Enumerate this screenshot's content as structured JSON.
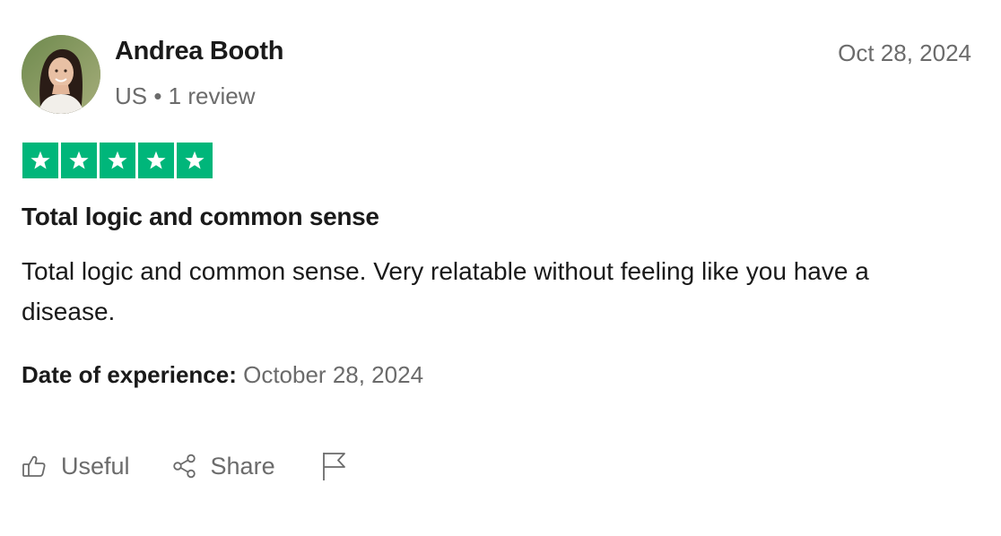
{
  "review": {
    "author": {
      "name": "Andrea Booth",
      "meta": "US • 1 review",
      "avatar_icon": "avatar-photo"
    },
    "date": "Oct 28, 2024",
    "rating": {
      "value": 5,
      "max": 5,
      "color": "#00b67a"
    },
    "title": "Total logic and common sense",
    "body": "Total logic and common sense. Very relatable without feeling like you have a disease.",
    "experience": {
      "label": "Date of experience:",
      "value": "October 28, 2024"
    }
  },
  "actions": {
    "useful_label": "Useful",
    "share_label": "Share",
    "useful_icon": "thumbs-up-icon",
    "share_icon": "share-icon",
    "report_icon": "flag-icon"
  }
}
